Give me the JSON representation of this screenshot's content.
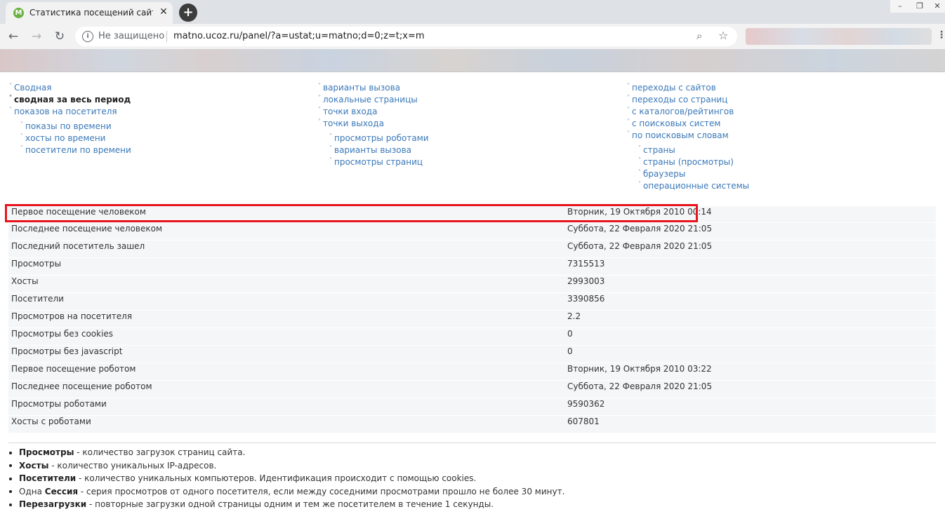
{
  "browser": {
    "tab_title": "Статистика посещений сайта m",
    "favicon_letter": "M",
    "security_label": "Не защищено",
    "url": "matno.ucoz.ru/panel/?a=ustat;u=matno;d=0;z=t;x=m"
  },
  "nav": {
    "col1": {
      "items": [
        {
          "label": "Сводная"
        },
        {
          "label": "сводная за весь период",
          "active": true
        },
        {
          "label": "показов на посетителя"
        }
      ],
      "sub": [
        {
          "label": "показы по времени"
        },
        {
          "label": "хосты по времени"
        },
        {
          "label": "посетители по времени"
        }
      ]
    },
    "col2": {
      "items": [
        {
          "label": "варианты вызова"
        },
        {
          "label": "локальные страницы"
        },
        {
          "label": "точки входа"
        },
        {
          "label": "точки выхода"
        }
      ],
      "sub": [
        {
          "label": "просмотры роботами"
        },
        {
          "label": "варианты вызова"
        },
        {
          "label": "просмотры страниц"
        }
      ]
    },
    "col3": {
      "items": [
        {
          "label": "переходы с сайтов"
        },
        {
          "label": "переходы со страниц"
        },
        {
          "label": "с каталогов/рейтингов"
        },
        {
          "label": "с поисковых систем"
        },
        {
          "label": "по поисковым словам"
        }
      ],
      "sub": [
        {
          "label": "страны"
        },
        {
          "label": "страны (просмотры)"
        },
        {
          "label": "браузеры"
        },
        {
          "label": "операционные системы"
        }
      ]
    }
  },
  "stats": [
    {
      "label": "Первое посещение человеком",
      "value": "Вторник, 19 Октября 2010 00:14"
    },
    {
      "label": "Последнее посещение человеком",
      "value": "Суббота, 22 Февраля 2020 21:05"
    },
    {
      "label": "Последний посетитель зашел",
      "value": "Суббота, 22 Февраля 2020 21:05"
    },
    {
      "label": "Просмотры",
      "value": "7315513"
    },
    {
      "label": "Хосты",
      "value": "2993003"
    },
    {
      "label": "Посетители",
      "value": "3390856"
    },
    {
      "label": "Просмотров на посетителя",
      "value": "2.2"
    },
    {
      "label": "Просмотры без cookies",
      "value": "0"
    },
    {
      "label": "Просмотры без javascript",
      "value": "0"
    },
    {
      "label": "Первое посещение роботом",
      "value": "Вторник, 19 Октября 2010 03:22"
    },
    {
      "label": "Последнее посещение роботом",
      "value": "Суббота, 22 Февраля 2020 21:05"
    },
    {
      "label": "Просмотры роботами",
      "value": "9590362"
    },
    {
      "label": "Хосты с роботами",
      "value": "607801"
    }
  ],
  "legend": [
    {
      "prefix": "",
      "term": "Просмотры",
      "text": " - количество загрузок страниц сайта."
    },
    {
      "prefix": "",
      "term": "Хосты",
      "text": " - количество уникальных IP-адресов."
    },
    {
      "prefix": "",
      "term": "Посетители",
      "text": " - количество уникальных компьютеров. Идентификация происходит с помощью cookies."
    },
    {
      "prefix": "Одна ",
      "term": "Сессия",
      "text": " - серия просмотров от одного посетителя, если между соседними просмотрами прошло не более 30 минут."
    },
    {
      "prefix": "",
      "term": "Перезагрузки",
      "text": " - повторные загрузки одной страницы одним и тем же посетителем в течение 1 секунды."
    }
  ],
  "colors": {
    "link": "#3a78b8",
    "highlight_border": "#e8141c",
    "row_bg": "#f5f6f8"
  },
  "icons": [
    "favicon-icon",
    "tab-close-icon",
    "new-tab-icon",
    "back-icon",
    "forward-icon",
    "reload-icon",
    "info-icon",
    "zoom-icon",
    "star-icon",
    "menu-icon",
    "minimize-icon",
    "maximize-icon",
    "window-close-icon"
  ]
}
